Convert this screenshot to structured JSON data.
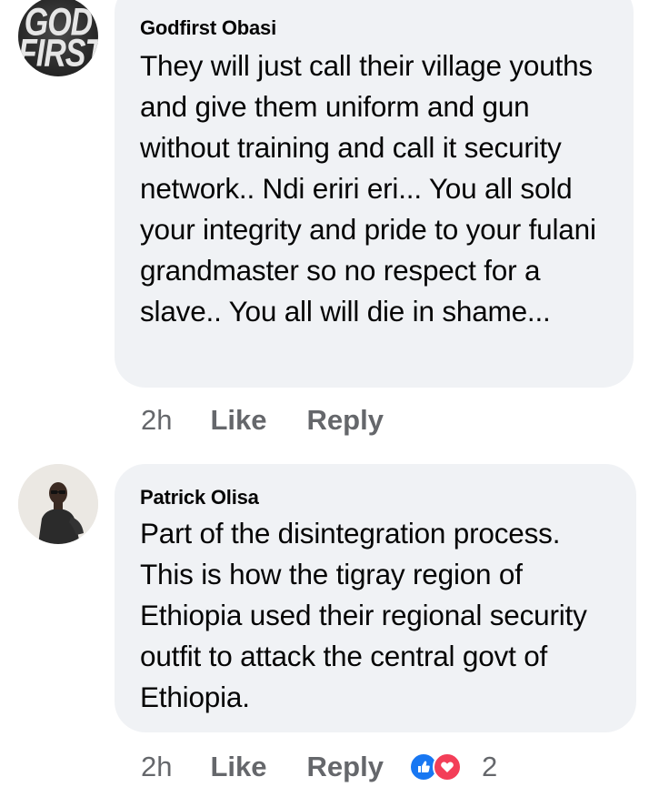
{
  "comments": [
    {
      "author": "Godfirst Obasi",
      "avatar_text_line1": "GOD",
      "avatar_text_line2": "FIRST",
      "text": "They will just call their village youths and give them uniform and gun without training and call it security network.. Ndi eriri eri... You all sold your integrity and pride to your fulani grandmaster so no respect for a slave.. You all will die in shame...",
      "time": "2h",
      "like_label": "Like",
      "reply_label": "Reply"
    },
    {
      "author": "Patrick Olisa",
      "text": "Part of the disintegration process. This is how the tigray region of Ethiopia used their regional security outfit to attack the central govt of Ethiopia.",
      "time": "2h",
      "like_label": "Like",
      "reply_label": "Reply",
      "reactions": {
        "icons": [
          "like-reaction-icon",
          "love-reaction-icon"
        ],
        "count": "2"
      }
    }
  ],
  "colors": {
    "bubble": "#f0f2f5",
    "meta_text": "#65676b",
    "like_blue": "#1877f2",
    "love_red": "#f33e58"
  }
}
